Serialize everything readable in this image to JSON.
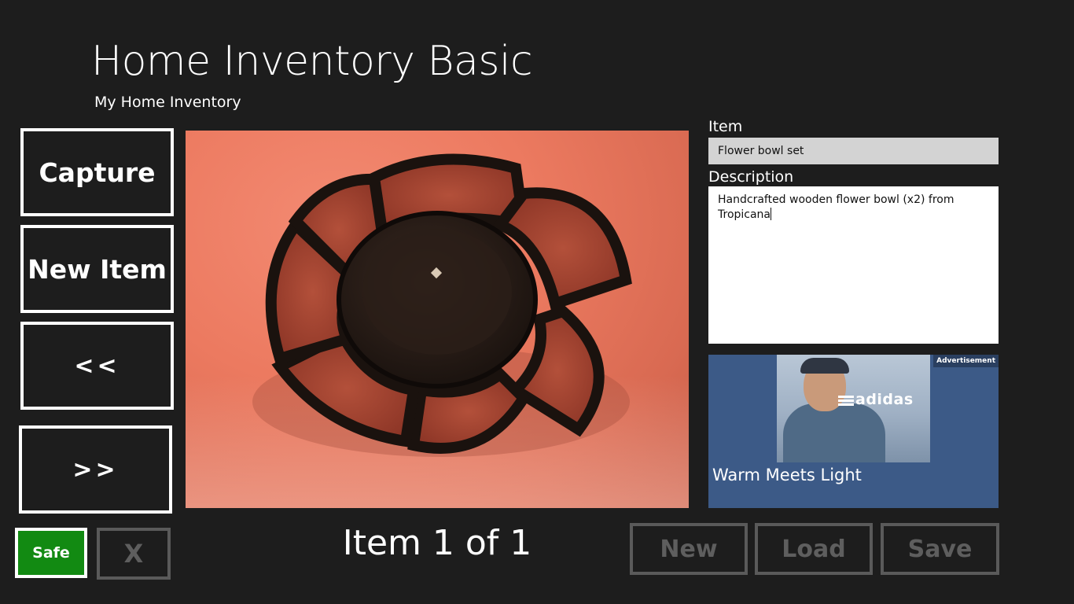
{
  "app": {
    "title": "Home Inventory Basic",
    "subtitle": "My Home Inventory"
  },
  "sidebar": {
    "capture_label": "Capture",
    "new_item_label": "New Item",
    "prev_label": "<<",
    "next_label": ">>",
    "safe_label": "Safe",
    "close_label": "X"
  },
  "main": {
    "status": "Item 1 of 1"
  },
  "form": {
    "item_label": "Item",
    "item_value": "Flower bowl set",
    "description_label": "Description",
    "description_value": "Handcrafted wooden flower bowl (x2) from Tropicana"
  },
  "ad": {
    "tag": "Advertisement",
    "brand": "adidas",
    "headline": "Warm Meets Light"
  },
  "commands": {
    "new_label": "New",
    "load_label": "Load",
    "save_label": "Save"
  },
  "colors": {
    "background": "#1d1d1d",
    "safe_green": "#128a12",
    "disabled_gray": "#5a5a5a",
    "ad_blue": "#3c5a87"
  }
}
